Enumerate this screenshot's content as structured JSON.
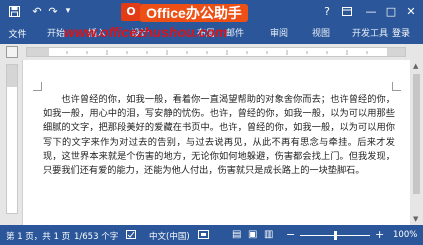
{
  "title_bar": {
    "brand_logo_text": "O",
    "brand_badge_text": "Office办公助手",
    "quick_access": [
      "save-icon",
      "undo-icon",
      "redo-icon",
      "customize-icon"
    ],
    "window_controls": {
      "help": "?",
      "min": "—",
      "max": "□",
      "close": "✕"
    }
  },
  "watermark": "www.officezhushou.com",
  "tabs": {
    "file": "文件",
    "home": "开始",
    "insert": "插入",
    "design": "设计",
    "layout": "布局",
    "mail": "邮件",
    "review": "审阅",
    "view": "视图",
    "dev": "开发工具",
    "user": "登录"
  },
  "document": {
    "paragraph": "也许曾经的你，如我一般，看着你一直渴望帮助的对象舍你而去；也许曾经的你，如我一般，用心中的泪，写安静的忧伤。也许，曾经的你，如我一般，以为可以用那些细腻的文字，把那段美好的爱藏在书页中。也许，曾经的你，如我一般，以为可以用你写下的文字来作为对过去的告别，与过去说再见，从此不再有思念与牵挂。后来才发现，这世界本来就是个伤害的地方，无论你如何地躲避，伤害都会找上门。但我发现，只要我们还有爱的能力，还能为他人付出，伤害就只是成长路上的一块垫脚石。"
  },
  "status_bar": {
    "page": "第 1 页，共 1 页",
    "words": "1/653 个字",
    "language": "中文(中国)",
    "zoom": "100%",
    "zoom_level_percent": 100
  },
  "colors": {
    "ribbon": "#2b579a",
    "brand_badge": "#ee4f15",
    "watermark": "#d8141b"
  }
}
